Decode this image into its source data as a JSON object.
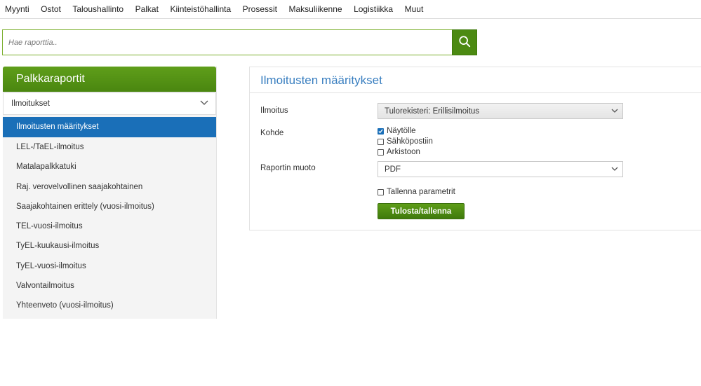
{
  "topnav": {
    "items": [
      "Myynti",
      "Ostot",
      "Taloushallinto",
      "Palkat",
      "Kiinteistöhallinta",
      "Prosessit",
      "Maksuliikenne",
      "Logistiikka",
      "Muut"
    ]
  },
  "search": {
    "placeholder": "Hae raporttia..",
    "icon": "search-icon"
  },
  "sidebar": {
    "title": "Palkkaraportit",
    "category": "Ilmoitukset",
    "items": [
      "Ilmoitusten määritykset",
      "LEL-/TaEL-ilmoitus",
      "Matalapalkkatuki",
      "Raj. verovelvollinen saajakohtainen",
      "Saajakohtainen erittely (vuosi-ilmoitus)",
      "TEL-vuosi-ilmoitus",
      "TyEL-kuukausi-ilmoitus",
      "TyEL-vuosi-ilmoitus",
      "Valvontailmoitus",
      "Yhteenveto (vuosi-ilmoitus)"
    ],
    "active_index": 0
  },
  "panel": {
    "title": "Ilmoitusten määritykset",
    "ilmoitus_label": "Ilmoitus",
    "ilmoitus_value": "Tulorekisteri: Erillisilmoitus",
    "kohde_label": "Kohde",
    "kohde_options": [
      {
        "label": "Näytölle",
        "checked": true
      },
      {
        "label": "Sähköpostiin",
        "checked": false
      },
      {
        "label": "Arkistoon",
        "checked": false
      }
    ],
    "muoto_label": "Raportin muoto",
    "muoto_value": "PDF",
    "save_params_label": "Tallenna parametrit",
    "save_params_checked": false,
    "submit_label": "Tulosta/tallenna"
  },
  "colors": {
    "brand_green": "#4c8a12",
    "active_blue": "#1a6fb8",
    "title_blue": "#3a7fc0"
  }
}
